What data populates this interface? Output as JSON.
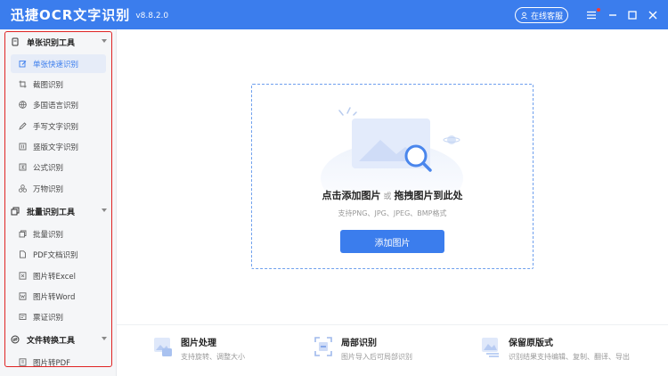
{
  "titlebar": {
    "app_name": "迅捷OCR文字识别",
    "version": "v8.8.2.0",
    "service_label": "在线客服"
  },
  "sidebar": {
    "section1": {
      "title": "单张识别工具",
      "items": [
        "单张快速识别",
        "截图识别",
        "多国语言识别",
        "手写文字识别",
        "竖版文字识别",
        "公式识别",
        "万物识别"
      ]
    },
    "section2": {
      "title": "批量识别工具",
      "items": [
        "批量识别",
        "PDF文档识别",
        "图片转Excel",
        "图片转Word",
        "票证识别"
      ]
    },
    "section3": {
      "title": "文件转换工具",
      "items": [
        "图片转PDF"
      ]
    },
    "active_item": "单张快速识别"
  },
  "main": {
    "drop_title_a": "点击添加图片",
    "drop_or": "或",
    "drop_title_b": "拖拽图片到此处",
    "drop_sub": "支持PNG、JPG、JPEG、BMP格式",
    "add_button": "添加图片"
  },
  "features": [
    {
      "title": "图片处理",
      "desc": "支持旋转、调整大小"
    },
    {
      "title": "局部识别",
      "desc": "图片导入后可局部识别"
    },
    {
      "title": "保留原版式",
      "desc": "识别结果支持编辑、复制、翻译、导出"
    }
  ],
  "colors": {
    "accent": "#3b7ded",
    "highlight_frame": "#e02424"
  }
}
